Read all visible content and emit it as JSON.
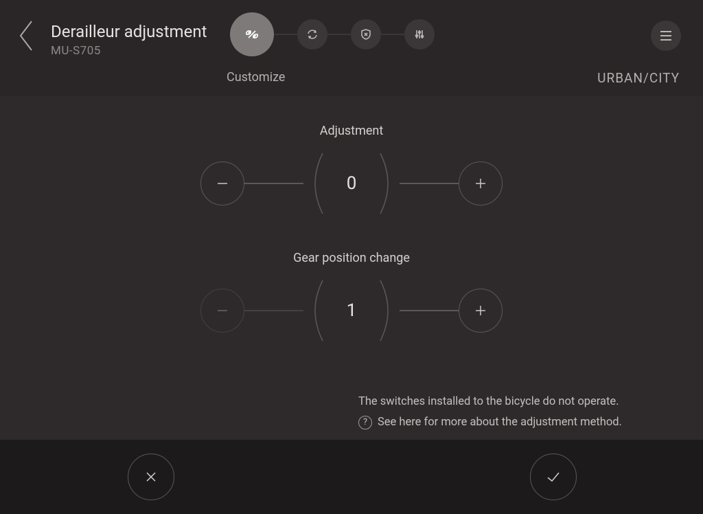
{
  "header": {
    "title": "Derailleur adjustment",
    "subtitle": "MU-S705",
    "step_label": "Customize",
    "mode": "URBAN/CITY"
  },
  "controls": {
    "adjustment": {
      "label": "Adjustment",
      "value": "0"
    },
    "gear": {
      "label": "Gear position change",
      "value": "1"
    }
  },
  "info": {
    "line1": "The switches installed to the bicycle do not operate.",
    "line2": "See here for more about the adjustment method."
  }
}
